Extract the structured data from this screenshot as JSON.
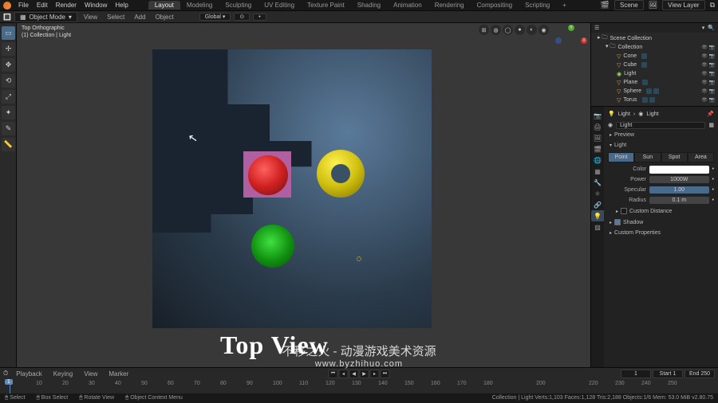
{
  "topbar": {
    "menus": [
      "File",
      "Edit",
      "Render",
      "Window",
      "Help"
    ],
    "workspaces": [
      "Layout",
      "Modeling",
      "Sculpting",
      "UV Editing",
      "Texture Paint",
      "Shading",
      "Animation",
      "Rendering",
      "Compositing",
      "Scripting"
    ],
    "active_workspace": "Layout",
    "scene_label": "Scene",
    "viewlayer_label": "View Layer"
  },
  "header": {
    "mode": "Object Mode",
    "menus": [
      "View",
      "Select",
      "Add",
      "Object"
    ],
    "orientation": "Global",
    "snap": "•",
    "pivot": "⊙"
  },
  "viewport": {
    "overlay_line1": "Top Orthographic",
    "overlay_line2": "(1) Collection | Light",
    "top_view_label": "Top View"
  },
  "outliner": {
    "root": "Scene Collection",
    "collection": "Collection",
    "items": [
      {
        "name": "Cone"
      },
      {
        "name": "Cube"
      },
      {
        "name": "Light"
      },
      {
        "name": "Plane"
      },
      {
        "name": "Sphere"
      },
      {
        "name": "Torus"
      }
    ]
  },
  "properties": {
    "breadcrumb_obj": "Light",
    "breadcrumb_data": "Light",
    "datablock": "Light",
    "panels": {
      "preview": "Preview",
      "light": "Light",
      "shadow": "Shadow",
      "custom_distance": "Custom Distance",
      "custom_properties": "Custom Properties"
    },
    "light_types": [
      "Point",
      "Sun",
      "Spot",
      "Area"
    ],
    "active_light_type": "Point",
    "rows": {
      "color_label": "Color",
      "power_label": "Power",
      "power_value": "1000W",
      "specular_label": "Specular",
      "specular_value": "1.00",
      "radius_label": "Radius",
      "radius_value": "0.1 m"
    }
  },
  "timeline": {
    "menus": [
      "Playback",
      "Keying",
      "View",
      "Marker"
    ],
    "ticks": [
      0,
      10,
      20,
      30,
      40,
      50,
      60,
      70,
      80,
      90,
      100,
      110,
      120,
      130,
      140,
      150,
      160,
      170,
      180,
      200,
      220,
      230,
      240,
      250
    ],
    "current_frame": "1",
    "start_label": "Start",
    "start_value": "1",
    "end_label": "End",
    "end_value": "250"
  },
  "statusbar": {
    "left": [
      "Select",
      "Box Select",
      "Rotate View",
      "Object Context Menu"
    ],
    "right": "Collection | Light   Verts:1,103   Faces:1,128   Tris:2,188   Objects:1/6   Mem: 53.0 MiB   v2.80.75"
  },
  "watermark": {
    "line1": "不移之火 - 动漫游戏美术资源",
    "line2": "www.byzhihuo.com"
  }
}
